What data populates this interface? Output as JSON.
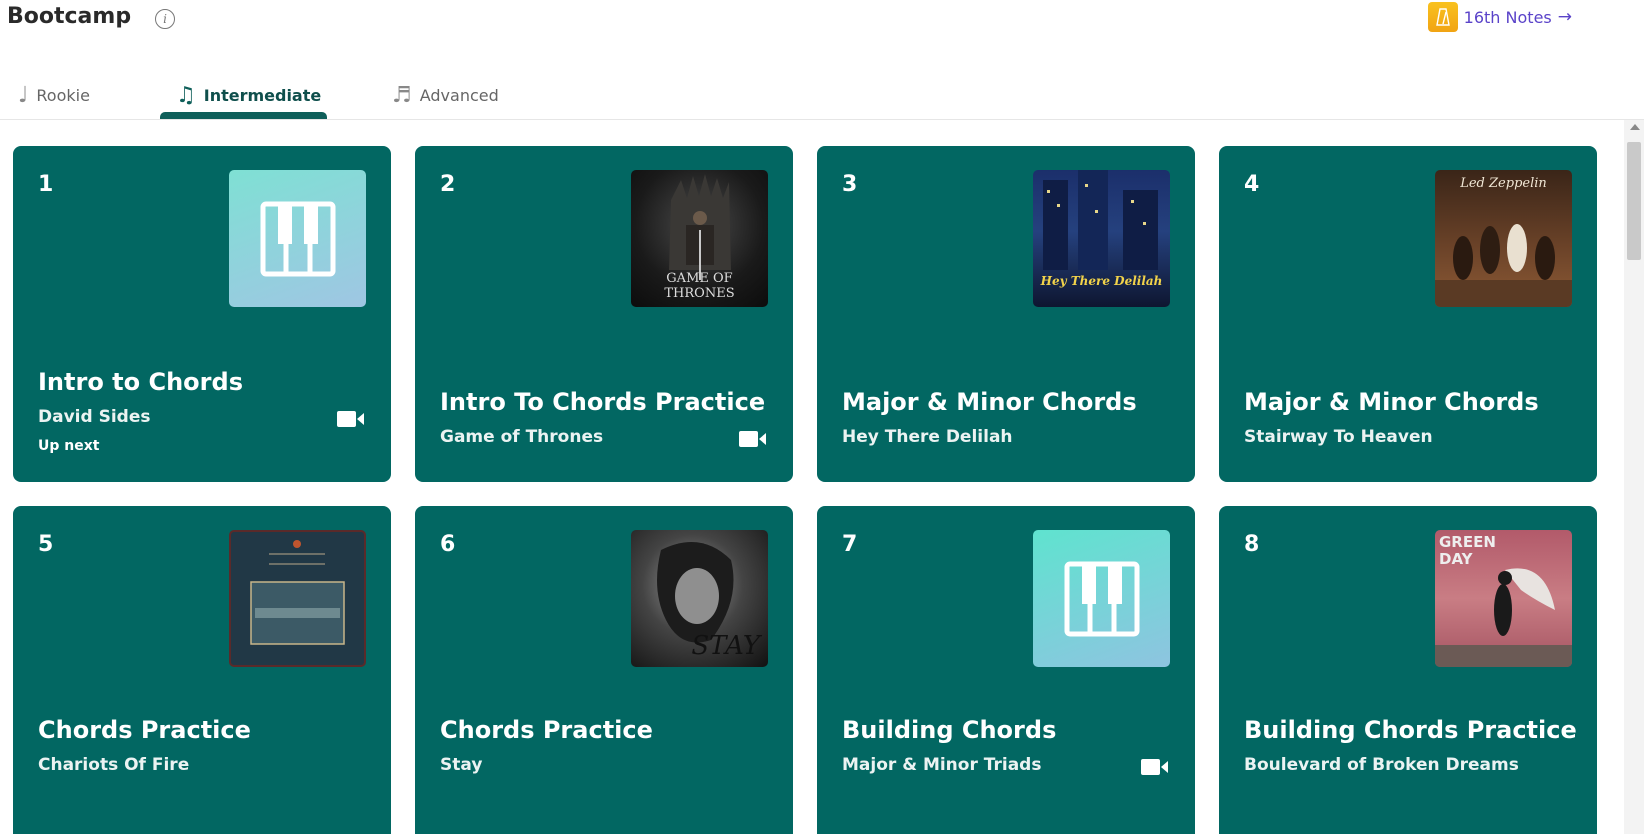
{
  "header": {
    "title": "Bootcamp",
    "info_glyph": "i",
    "notes_link": {
      "label": "16th Notes",
      "arrow": "→",
      "icon": "metronome-icon"
    }
  },
  "tabs": [
    {
      "label": "Rookie",
      "icon": "♩",
      "active": false
    },
    {
      "label": "Intermediate",
      "icon": "♫",
      "active": true
    },
    {
      "label": "Advanced",
      "icon": "♬",
      "active": false
    }
  ],
  "cards": [
    {
      "number": "1",
      "title": "Intro to Chords",
      "subtitle": "David Sides",
      "status": "Up next",
      "video": true,
      "thumb": "piano"
    },
    {
      "number": "2",
      "title": "Intro To Chords Practice",
      "subtitle": "Game of Thrones",
      "status": "",
      "video": true,
      "thumb": "game-of-thrones-album-art",
      "thumb_text": "GAME OF THRONES"
    },
    {
      "number": "3",
      "title": "Major & Minor Chords",
      "subtitle": "Hey There Delilah",
      "status": "",
      "video": false,
      "thumb": "hey-there-delilah-album-art",
      "thumb_text": "Hey There Delilah"
    },
    {
      "number": "4",
      "title": "Major & Minor Chords",
      "subtitle": "Stairway To Heaven",
      "status": "",
      "video": false,
      "thumb": "led-zeppelin-album-art",
      "thumb_text": "Led Zeppelin"
    },
    {
      "number": "5",
      "title": "Chords Practice",
      "subtitle": "Chariots Of Fire",
      "status": "",
      "video": false,
      "thumb": "chariots-of-fire-album-art"
    },
    {
      "number": "6",
      "title": "Chords Practice",
      "subtitle": "Stay",
      "status": "",
      "video": false,
      "thumb": "stay-album-art",
      "thumb_text": "STAY"
    },
    {
      "number": "7",
      "title": "Building Chords",
      "subtitle": "Major & Minor Triads",
      "status": "",
      "video": true,
      "thumb": "piano"
    },
    {
      "number": "8",
      "title": "Building Chords Practice",
      "subtitle": "Boulevard of Broken Dreams",
      "status": "",
      "video": false,
      "thumb": "green-day-album-art",
      "thumb_text": "GREEN DAY"
    }
  ],
  "colors": {
    "card_bg": "#026762",
    "accent_purple": "#5a43c9",
    "tab_active": "#0f5f5a"
  }
}
